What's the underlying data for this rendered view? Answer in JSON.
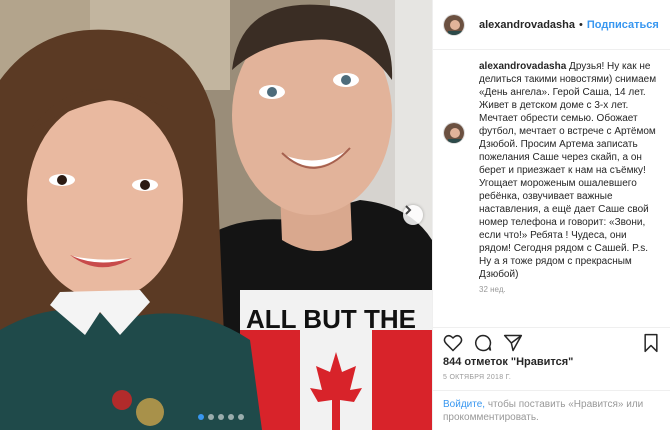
{
  "post": {
    "username": "alexandrovadasha",
    "separator": "•",
    "follow_label": "Подписаться"
  },
  "photo": {
    "shirt_text": "ALL BUT THE",
    "carousel_total": 5,
    "carousel_active": 0
  },
  "caption": {
    "username": "alexandrovadasha",
    "text": "Друзья! Ну как не делиться такими новостями) снимаем «День ангела». Герой Саша, 14 лет. Живет в детском доме с 3-х лет. Мечтает обрести семью. Обожает футбол, мечтает о встрече с Артёмом Дзюбой. Просим Артема записать пожелания Саше через скайп, а он берет и приезжает к нам на съёмку! Угощает мороженым ошалевшего ребёнка, озвучивает важные наставления, а ещё дает Саше свой номер телефона и говорит: «Звони, если что!» Ребята ! Чудеса, они рядом! Сегодня рядом с Сашей. P.s. Ну а я тоже рядом с прекрасным Дзюбой)",
    "ago": "32 нед."
  },
  "stats": {
    "likes": "844 отметок \"Нравится\"",
    "date": "5 ОКТЯБРЯ 2018 Г."
  },
  "login_prompt": {
    "link": "Войдите,",
    "rest": " чтобы поставить «Нравится» или прокомментировать."
  },
  "icons": [
    "heart-icon",
    "comment-icon",
    "share-icon",
    "bookmark-icon",
    "chevron-right-icon"
  ],
  "colors": {
    "link": "#3897f0",
    "border": "#efefef",
    "muted": "#999999"
  }
}
